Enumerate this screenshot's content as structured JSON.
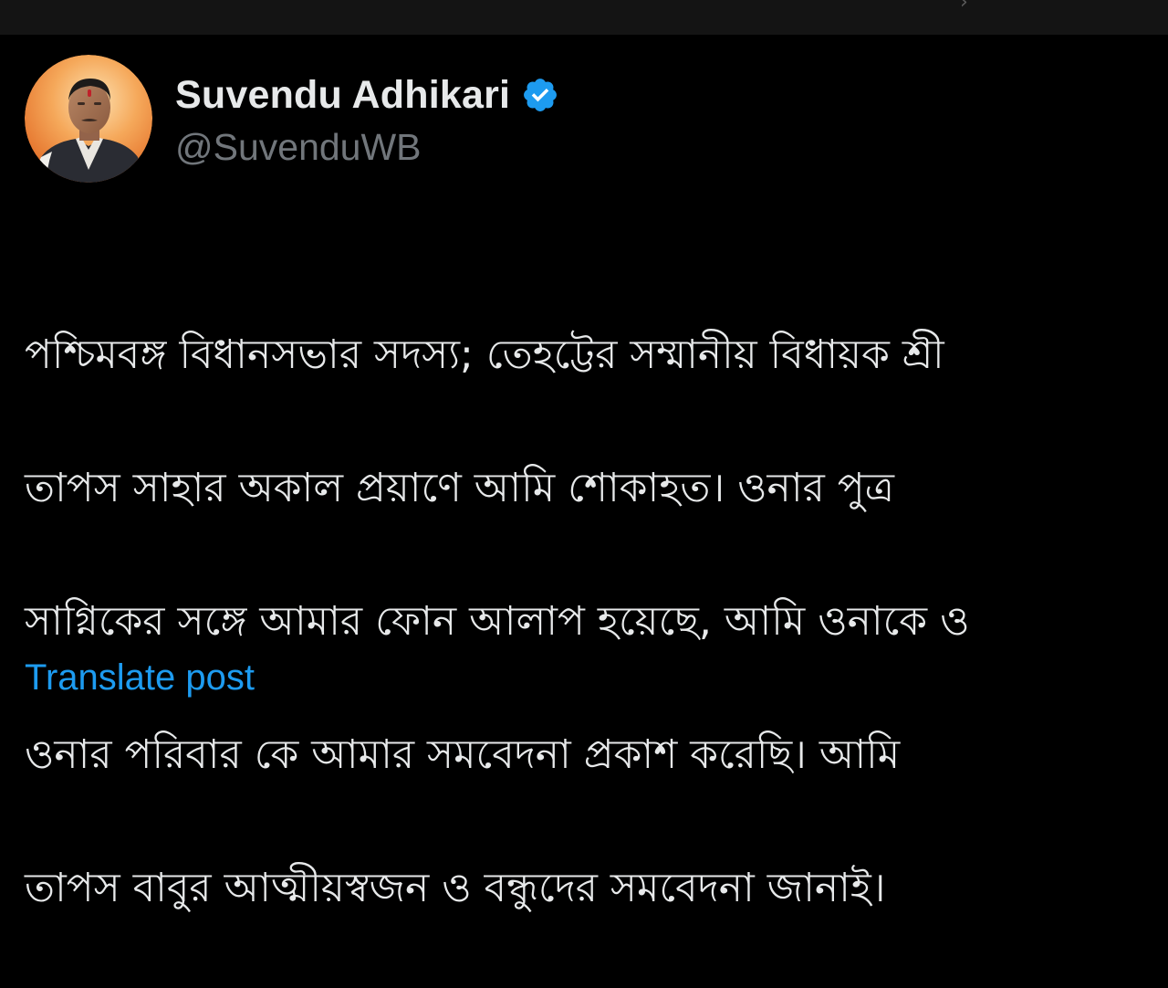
{
  "author": {
    "display_name": "Suvendu Adhikari",
    "handle": "@SuvenduWB",
    "verified": true,
    "verified_badge_color": "#1d9bf0",
    "avatar_icon": "profile-photo"
  },
  "post": {
    "lines": [
      "পশ্চিমবঙ্গ বিধানসভার সদস্য; তেহট্টের সম্মানীয় বিধায়ক শ্রী",
      "তাপস সাহার অকাল প্রয়াণে আমি শোকাহত। ওনার পুত্র",
      "সাগ্নিকের সঙ্গে আমার ফোন আলাপ হয়েছে, আমি ওনাকে ও",
      "ওনার পরিবার কে আমার সমবেদনা প্রকাশ করেছি। আমি",
      "তাপস বাবুর আত্মীয়স্বজন ও বন্ধুদের সমবেদনা জানাই।"
    ]
  },
  "actions": {
    "translate_label": "Translate post"
  },
  "theme": {
    "background": "#000000",
    "top_bar": "#141414",
    "primary_text": "#e7e9ea",
    "secondary_text": "#71767b",
    "link": "#1d9bf0"
  }
}
